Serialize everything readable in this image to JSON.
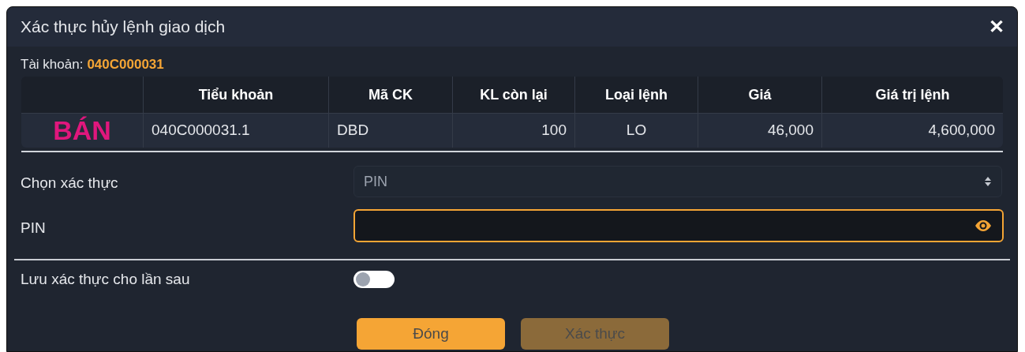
{
  "dialog": {
    "title": "Xác thực hủy lệnh giao dịch",
    "close_label": "✕"
  },
  "account": {
    "label": "Tài khoản:",
    "value": "040C000031"
  },
  "table": {
    "columns": [
      "Tiểu khoản",
      "Mã CK",
      "KL còn lại",
      "Loại lệnh",
      "Giá",
      "Giá trị lệnh"
    ],
    "rows": [
      {
        "side": "BÁN",
        "cells": [
          "040C000031.1",
          "DBD",
          "100",
          "LO",
          "46,000",
          "4,600,000"
        ]
      }
    ]
  },
  "form": {
    "auth_label": "Chọn xác thực",
    "auth_value": "PIN",
    "pin_label": "PIN",
    "pin_focused": true,
    "remember_label": "Lưu xác thực cho lần sau",
    "remember_on": false
  },
  "buttons": [
    {
      "label": "Đóng",
      "disabled": false
    },
    {
      "label": "Xác thực",
      "disabled": true
    }
  ]
}
